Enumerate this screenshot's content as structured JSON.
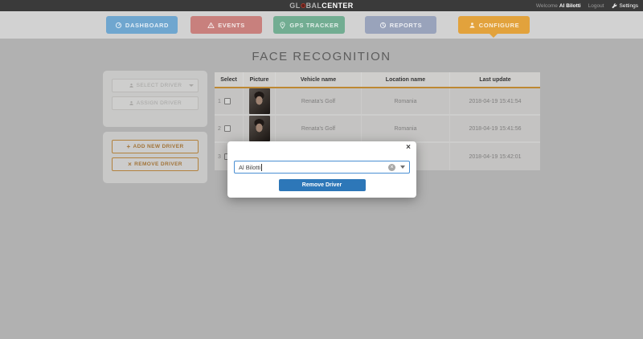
{
  "topbar": {
    "logo_part1": "GL",
    "logo_part2": "BAL",
    "logo_part3": "CENTER",
    "welcome_prefix": "Welcome",
    "username": "Al Bilotti",
    "logout_label": "Logout",
    "settings_label": "Settings"
  },
  "nav": {
    "items": [
      {
        "label": "DASHBOARD",
        "icon": "gauge-icon",
        "color": "#6fa6cf",
        "active": false
      },
      {
        "label": "EVENTS",
        "icon": "warning-icon",
        "color": "#c8807d",
        "active": false
      },
      {
        "label": "GPS TRACKER",
        "icon": "location-pin-icon",
        "color": "#72ad92",
        "active": false
      },
      {
        "label": "REPORTS",
        "icon": "pie-chart-icon",
        "color": "#99a3bb",
        "active": false
      },
      {
        "label": "CONFIGURE",
        "icon": "person-icon",
        "color": "#e2a23c",
        "active": true
      }
    ]
  },
  "page": {
    "title": "FACE RECOGNITION"
  },
  "sidebar": {
    "driver_panel": {
      "select_driver_label": "SELECT DRIVER",
      "assign_driver_label": "ASSIGN DRIVER"
    },
    "manage_panel": {
      "add_icon": "+",
      "add_label": "ADD NEW DRIVER",
      "remove_icon": "×",
      "remove_label": "REMOVE DRIVER"
    }
  },
  "table": {
    "columns": [
      "Select",
      "Picture",
      "Vehicle name",
      "Location name",
      "Last update"
    ],
    "rows": [
      {
        "num": "1",
        "vehicle": "Renata's Golf",
        "location": "Romania",
        "updated": "2018-04-19 15:41:54"
      },
      {
        "num": "2",
        "vehicle": "Renata's Golf",
        "location": "Romania",
        "updated": "2018-04-19 15:41:56"
      },
      {
        "num": "3",
        "vehicle": "",
        "location": "",
        "updated": "2018-04-19 15:42:01"
      }
    ]
  },
  "modal": {
    "close_glyph": "×",
    "driver_input_value": "Al Bilotti",
    "clear_glyph": "×",
    "remove_button_label": "Remove Driver"
  },
  "colors": {
    "topbar_bg": "#3a3a3a",
    "accent_orange": "#e2a23c",
    "primary_blue": "#2d77b8",
    "input_focus_blue": "#4a8fd3"
  }
}
